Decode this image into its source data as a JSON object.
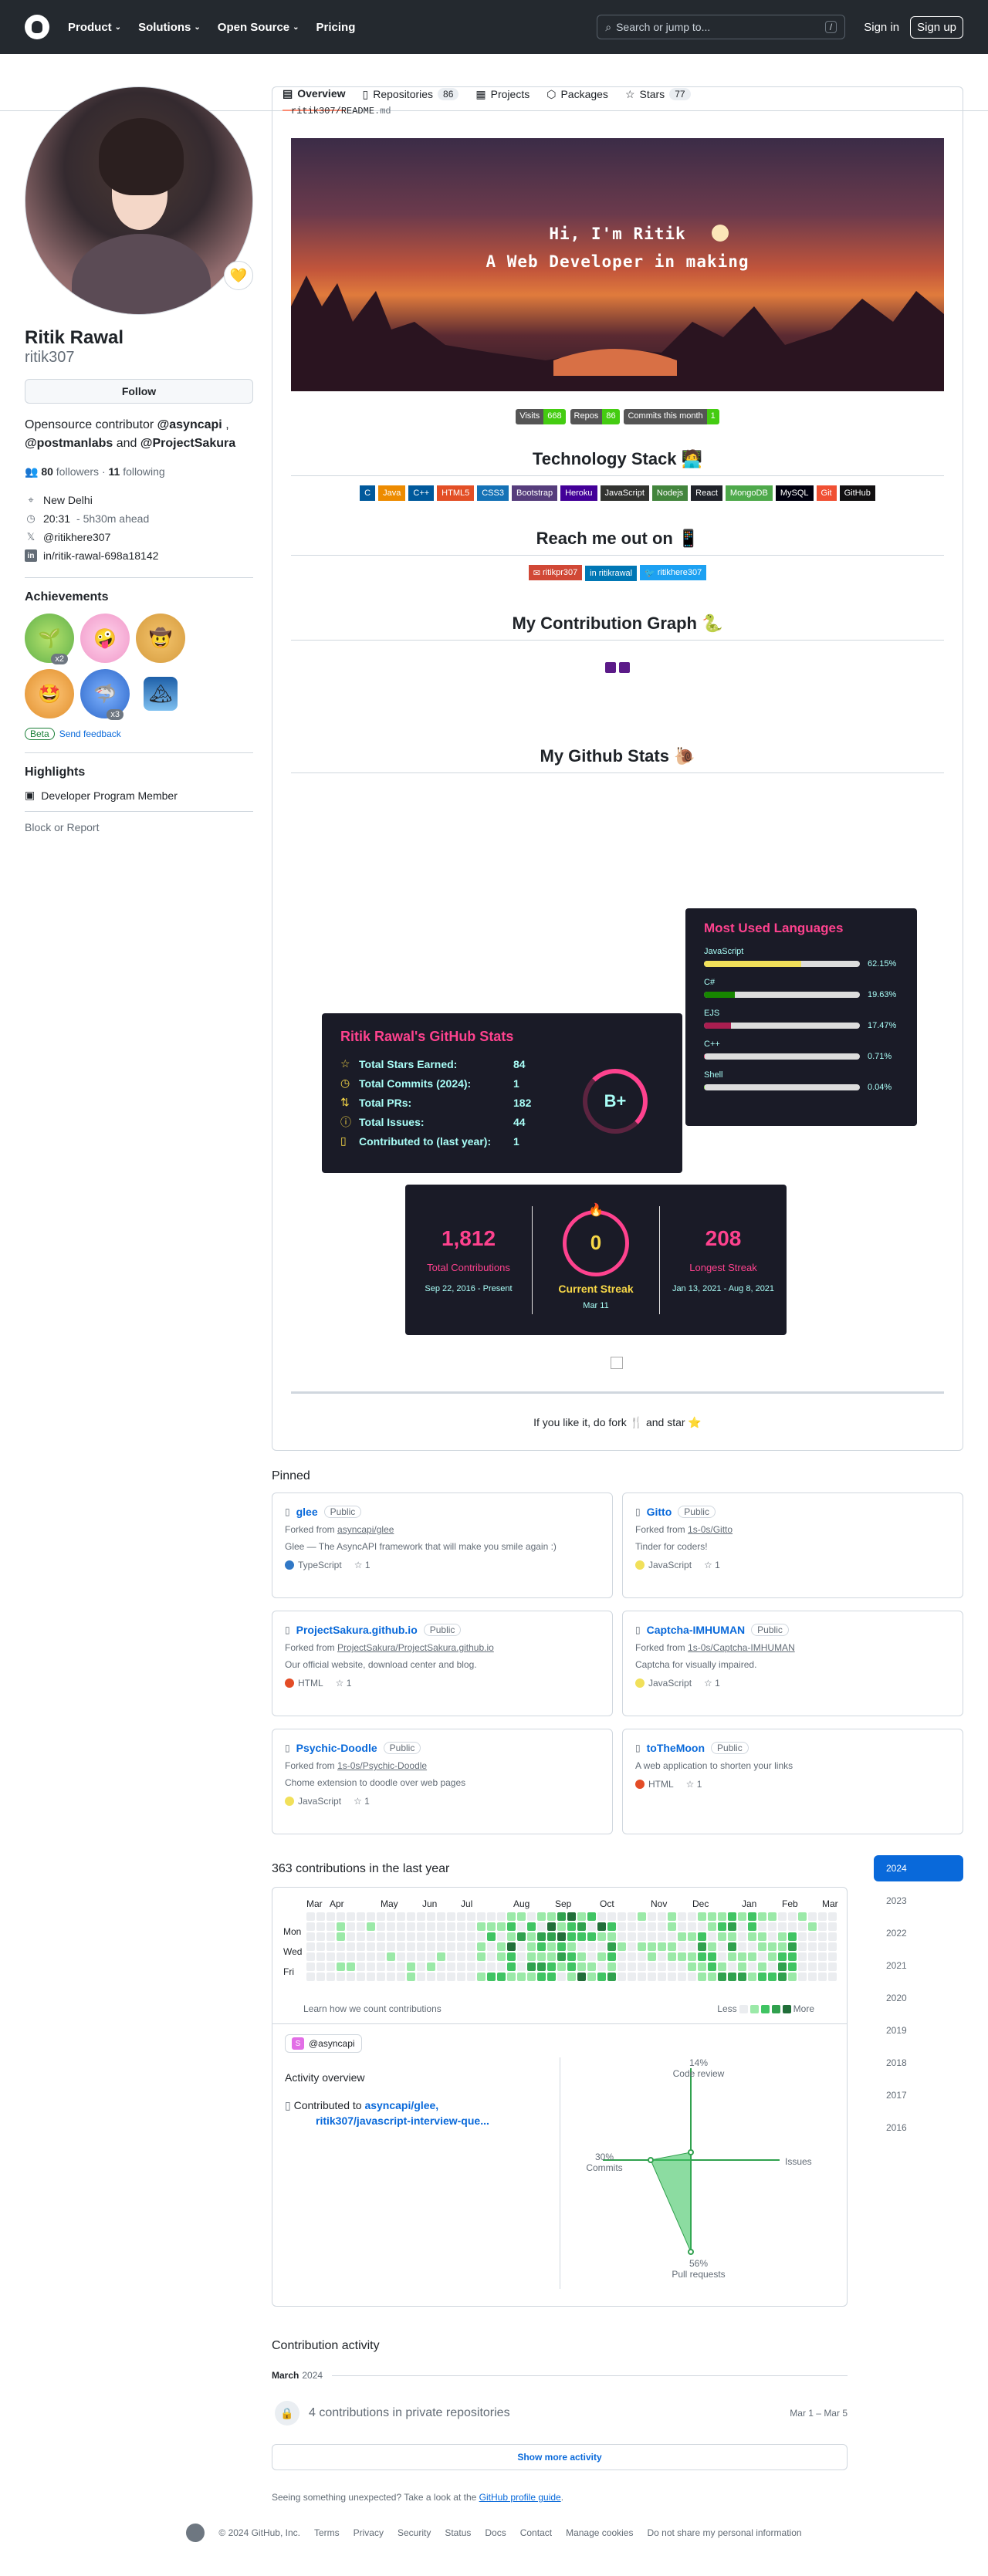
{
  "header": {
    "nav": [
      "Product",
      "Solutions",
      "Open Source",
      "Pricing"
    ],
    "search_placeholder": "Search or jump to...",
    "search_key": "/",
    "signin": "Sign in",
    "signup": "Sign up"
  },
  "tabs": [
    {
      "label": "Overview",
      "count": ""
    },
    {
      "label": "Repositories",
      "count": "86"
    },
    {
      "label": "Projects",
      "count": ""
    },
    {
      "label": "Packages",
      "count": ""
    },
    {
      "label": "Stars",
      "count": "77"
    }
  ],
  "profile": {
    "name": "Ritik Rawal",
    "login": "ritik307",
    "follow": "Follow",
    "bio_prefix": "Opensource contributor",
    "bio_org1": "@asyncapi",
    "bio_sep1": ",",
    "bio_org2": "@postmanlabs",
    "bio_and": "and",
    "bio_org3": "@ProjectSakura",
    "followers": "80",
    "followers_label": "followers",
    "dot": "·",
    "following": "11",
    "following_label": "following",
    "location": "New Delhi",
    "time": "20:31",
    "time_suffix": "- 5h30m ahead",
    "twitter": "@ritikhere307",
    "linkedin": "in/ritik-rawal-698a18142"
  },
  "achievements": {
    "title": "Achievements",
    "badges": [
      {
        "name": "pair-extraordinaire-icon",
        "count": "x2"
      },
      {
        "name": "yolo-icon",
        "count": ""
      },
      {
        "name": "quickdraw-icon",
        "count": ""
      },
      {
        "name": "starstruck-icon",
        "count": ""
      },
      {
        "name": "pull-shark-icon",
        "count": "x3"
      },
      {
        "name": "arctic-code-vault-icon",
        "count": ""
      }
    ],
    "beta": "Beta",
    "feedback": "Send feedback"
  },
  "highlights": {
    "title": "Highlights",
    "item": "Developer Program Member",
    "report": "Block or Report"
  },
  "readme": {
    "user": "ritik307",
    "slash": "/",
    "file": "README",
    "ext": ".md",
    "banner_line1": "Hi, I'm Ritik",
    "banner_line2": "A Web Developer in making",
    "counters": [
      {
        "label": "Visits",
        "value": "668",
        "color": "#4c1"
      },
      {
        "label": "Repos",
        "value": "86",
        "color": "#4c1"
      },
      {
        "label": "Commits this month",
        "value": "1",
        "color": "#4c1"
      }
    ],
    "tech_title": "Technology Stack",
    "tech": [
      {
        "label": "C",
        "color": "#00599C"
      },
      {
        "label": "Java",
        "color": "#ED8B00"
      },
      {
        "label": "C++",
        "color": "#00599C"
      },
      {
        "label": "HTML5",
        "color": "#E34F26"
      },
      {
        "label": "CSS3",
        "color": "#1572B6"
      },
      {
        "label": "Bootstrap",
        "color": "#563D7C"
      },
      {
        "label": "Heroku",
        "color": "#430098"
      },
      {
        "label": "JavaScript",
        "color": "#323330"
      },
      {
        "label": "Nodejs",
        "color": "#43853D"
      },
      {
        "label": "React",
        "color": "#20232a"
      },
      {
        "label": "MongoDB",
        "color": "#4ea94b"
      },
      {
        "label": "MySQL",
        "color": "#00000F"
      },
      {
        "label": "Git",
        "color": "#F05033"
      },
      {
        "label": "GitHub",
        "color": "#121011"
      }
    ],
    "reach_title": "Reach me out on",
    "socials": [
      {
        "label": "ritikpr307",
        "color": "#D14836"
      },
      {
        "label": "ritikrawal",
        "color": "#0077B5"
      },
      {
        "label": "ritikhere307",
        "color": "#1DA1F2"
      }
    ],
    "contrib_title": "My Contribution Graph",
    "stats_title": "My Github Stats",
    "stats_card": {
      "title": "Ritik Rawal's GitHub Stats",
      "rows": [
        {
          "label": "Total Stars Earned:",
          "value": "84"
        },
        {
          "label": "Total Commits (2024):",
          "value": "1"
        },
        {
          "label": "Total PRs:",
          "value": "182"
        },
        {
          "label": "Total Issues:",
          "value": "44"
        },
        {
          "label": "Contributed to (last year):",
          "value": "1"
        }
      ],
      "grade": "B+"
    },
    "langs_card": {
      "title": "Most Used Languages",
      "items": [
        {
          "name": "JavaScript",
          "pct": "62.15%",
          "color": "#f1e05a",
          "frac": 0.6215
        },
        {
          "name": "C#",
          "pct": "19.63%",
          "color": "#178600",
          "frac": 0.1963
        },
        {
          "name": "EJS",
          "pct": "17.47%",
          "color": "#a91e50",
          "frac": 0.1747
        },
        {
          "name": "C++",
          "pct": "0.71%",
          "color": "#f34b7d",
          "frac": 0.0071
        },
        {
          "name": "Shell",
          "pct": "0.04%",
          "color": "#89e051",
          "frac": 0.0004
        }
      ]
    },
    "streak_card": {
      "total": "1,812",
      "total_label": "Total Contributions",
      "total_range": "Sep 22, 2016 - Present",
      "current": "0",
      "current_label": "Current Streak",
      "current_date": "Mar 11",
      "longest": "208",
      "longest_label": "Longest Streak",
      "longest_range": "Jan 13, 2021 - Aug 8, 2021"
    },
    "footer_text": "If you like it, do fork 🍴 and star ⭐"
  },
  "pinned": {
    "title": "Pinned",
    "items": [
      {
        "repo": "glee",
        "vis": "Public",
        "fork_prefix": "Forked from",
        "fork": "asyncapi/glee",
        "desc": "Glee — The AsyncAPI framework that will make you smile again :)",
        "lang": "TypeScript",
        "color": "#3178c6",
        "stars": "1"
      },
      {
        "repo": "Gitto",
        "vis": "Public",
        "fork_prefix": "Forked from",
        "fork": "1s-0s/Gitto",
        "desc": "Tinder for coders!",
        "lang": "JavaScript",
        "color": "#f1e05a",
        "stars": "1"
      },
      {
        "repo": "ProjectSakura.github.io",
        "vis": "Public",
        "fork_prefix": "Forked from",
        "fork": "ProjectSakura/ProjectSakura.github.io",
        "desc": "Our official website, download center and blog.",
        "lang": "HTML",
        "color": "#e34c26",
        "stars": "1"
      },
      {
        "repo": "Captcha-IMHUMAN",
        "vis": "Public",
        "fork_prefix": "Forked from",
        "fork": "1s-0s/Captcha-IMHUMAN",
        "desc": "Captcha for visually impaired.",
        "lang": "JavaScript",
        "color": "#f1e05a",
        "stars": "1"
      },
      {
        "repo": "Psychic-Doodle",
        "vis": "Public",
        "fork_prefix": "Forked from",
        "fork": "1s-0s/Psychic-Doodle",
        "desc": "Chome extension to doodle over web pages",
        "lang": "JavaScript",
        "color": "#f1e05a",
        "stars": "1"
      },
      {
        "repo": "toTheMoon",
        "vis": "Public",
        "fork_prefix": "",
        "fork": "",
        "desc": "A web application to shorten your links",
        "lang": "HTML",
        "color": "#e34c26",
        "stars": "1"
      }
    ]
  },
  "contributions": {
    "title": "363 contributions in the last year",
    "months": [
      "Mar",
      "Apr",
      "May",
      "Jun",
      "Jul",
      "Aug",
      "Sep",
      "Oct",
      "Nov",
      "Dec",
      "Jan",
      "Feb",
      "Mar"
    ],
    "days": [
      "Mon",
      "Wed",
      "Fri"
    ],
    "learn": "Learn how we count contributions",
    "less": "Less",
    "more": "More",
    "org": "@asyncapi",
    "activity_title": "Activity overview",
    "contributed_prefix": "Contributed to",
    "contributed_repos": "asyncapi/glee,",
    "contributed_repos2": "ritik307/javascript-interview-que...",
    "radar": {
      "code_review_pct": "14%",
      "code_review": "Code review",
      "commits_pct": "30%",
      "commits": "Commits",
      "issues": "Issues",
      "pr_pct": "56%",
      "pr": "Pull requests"
    },
    "years": [
      "2024",
      "2023",
      "2022",
      "2021",
      "2020",
      "2019",
      "2018",
      "2017",
      "2016"
    ],
    "activity_header": "Contribution activity",
    "month_label": "March",
    "month_year": "2024",
    "private_text": "4 contributions in private repositories",
    "private_range": "Mar 1 – Mar 5",
    "show_more": "Show more activity",
    "unexpected": "Seeing something unexpected? Take a look at the",
    "guide": "GitHub profile guide",
    "guide_end": "."
  },
  "footer": {
    "copyright": "© 2024 GitHub, Inc.",
    "links": [
      "Terms",
      "Privacy",
      "Security",
      "Status",
      "Docs",
      "Contact",
      "Manage cookies",
      "Do not share my personal information"
    ]
  }
}
